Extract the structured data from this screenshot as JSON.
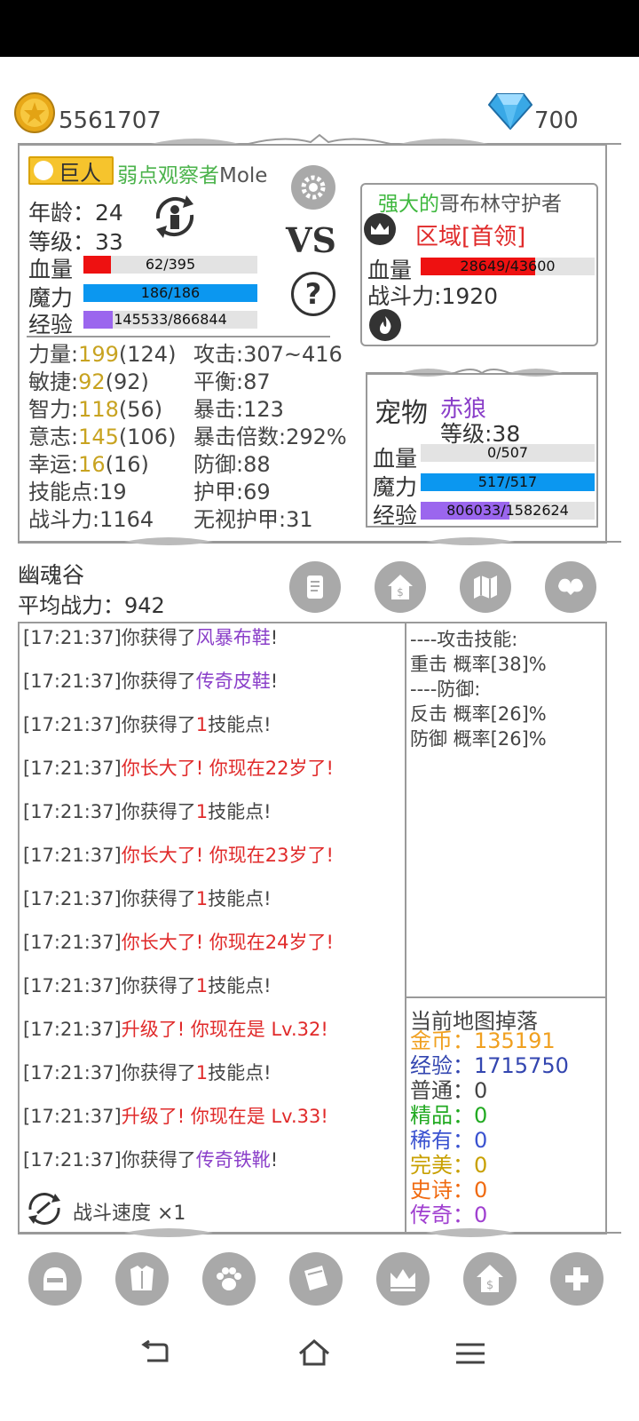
{
  "currency": {
    "gold": "5561707",
    "gems": "700"
  },
  "player": {
    "race": "巨人",
    "title": "弱点观察者",
    "name": "Mole",
    "age_label": "年龄：",
    "age": "24",
    "level_label": "等级：",
    "level": "33",
    "hp": {
      "label": "血量",
      "text": "62/395",
      "fraction": 0.157,
      "color": "#ee1111"
    },
    "mp": {
      "label": "魔力",
      "text": "186/186",
      "fraction": 1.0,
      "color": "#0b97f0"
    },
    "exp": {
      "label": "经验",
      "text": "145533/866844",
      "fraction": 0.168,
      "color": "#9b66ee"
    }
  },
  "vs_label": "VS",
  "enemy": {
    "prefix": "强大的",
    "name": "哥布林守护者",
    "region": "区域[首领]",
    "hp": {
      "label": "血量",
      "text": "28649/43600",
      "fraction": 0.657,
      "color": "#ee1111"
    },
    "power": "战斗力:1920"
  },
  "stats_left": [
    {
      "label": "力量:",
      "value": "199",
      "base": "(124)"
    },
    {
      "label": "敏捷:",
      "value": "92",
      "base": "(92)"
    },
    {
      "label": "智力:",
      "value": "118",
      "base": "(56)"
    },
    {
      "label": "意志:",
      "value": "145",
      "base": "(106)"
    },
    {
      "label": "幸运:",
      "value": "16",
      "base": "(16)"
    },
    {
      "label": "技能点:19",
      "value": "",
      "base": ""
    },
    {
      "label": "战斗力:1164",
      "value": "",
      "base": ""
    }
  ],
  "stats_right": [
    "攻击:307~416",
    "平衡:87",
    "暴击:123",
    "暴击倍数:292%",
    "防御:88",
    "护甲:69",
    "无视护甲:31"
  ],
  "pet": {
    "label": "宠物",
    "name": "赤狼",
    "level": "等级:38",
    "hp": {
      "label": "血量",
      "text": "0/507",
      "fraction": 0.0,
      "color": "#ee1111"
    },
    "mp": {
      "label": "魔力",
      "text": "517/517",
      "fraction": 1.0,
      "color": "#0b97f0"
    },
    "exp": {
      "label": "经验",
      "text": "806033/1582624",
      "fraction": 0.509,
      "color": "#9b66ee"
    }
  },
  "area": {
    "name": "幽魂谷",
    "avg_power": "平均战力：942"
  },
  "log": [
    {
      "time": "[17:21:37]",
      "pre": "你获得了",
      "hl": "风暴布鞋",
      "post": "!",
      "style": "purple"
    },
    {
      "time": "[17:21:37]",
      "pre": "你获得了",
      "hl": "传奇皮鞋",
      "post": "!",
      "style": "purple"
    },
    {
      "time": "[17:21:37]",
      "pre": "你获得了",
      "hl": "1",
      "post": "技能点!",
      "style": "red"
    },
    {
      "time": "[17:21:37]",
      "pre": "",
      "hl": "你长大了! 你现在22岁了!",
      "post": "",
      "style": "red"
    },
    {
      "time": "[17:21:37]",
      "pre": "你获得了",
      "hl": "1",
      "post": "技能点!",
      "style": "red"
    },
    {
      "time": "[17:21:37]",
      "pre": "",
      "hl": "你长大了! 你现在23岁了!",
      "post": "",
      "style": "red"
    },
    {
      "time": "[17:21:37]",
      "pre": "你获得了",
      "hl": "1",
      "post": "技能点!",
      "style": "red"
    },
    {
      "time": "[17:21:37]",
      "pre": "",
      "hl": "你长大了! 你现在24岁了!",
      "post": "",
      "style": "red"
    },
    {
      "time": "[17:21:37]",
      "pre": "你获得了",
      "hl": "1",
      "post": "技能点!",
      "style": "red"
    },
    {
      "time": "[17:21:37]",
      "pre": "",
      "hl": "升级了! 你现在是 Lv.32!",
      "post": "",
      "style": "red"
    },
    {
      "time": "[17:21:37]",
      "pre": "你获得了",
      "hl": "1",
      "post": "技能点!",
      "style": "red"
    },
    {
      "time": "[17:21:37]",
      "pre": "",
      "hl": "升级了! 你现在是 Lv.33!",
      "post": "",
      "style": "red"
    },
    {
      "time": "[17:21:37]",
      "pre": "你获得了",
      "hl": "传奇铁靴",
      "post": "!",
      "style": "purple"
    }
  ],
  "battle_speed": "战斗速度 ×1",
  "skills": [
    "----攻击技能:",
    "重击 概率[38]%",
    "----防御:",
    "反击 概率[26]%",
    "防御 概率[26]%"
  ],
  "drops": {
    "title": "当前地图掉落",
    "items": [
      {
        "label": "金币：",
        "value": "135191",
        "color": "#f0a020"
      },
      {
        "label": "经验：",
        "value": "1715750",
        "color": "#3346b0"
      },
      {
        "label": "普通：",
        "value": "0",
        "color": "#444444"
      },
      {
        "label": "精品：",
        "value": "0",
        "color": "#22aa22"
      },
      {
        "label": "稀有：",
        "value": "0",
        "color": "#3a52d0"
      },
      {
        "label": "完美：",
        "value": "0",
        "color": "#c8a000"
      },
      {
        "label": "史诗：",
        "value": "0",
        "color": "#f06a10"
      },
      {
        "label": "传奇：",
        "value": "0",
        "color": "#a040d0"
      }
    ]
  }
}
